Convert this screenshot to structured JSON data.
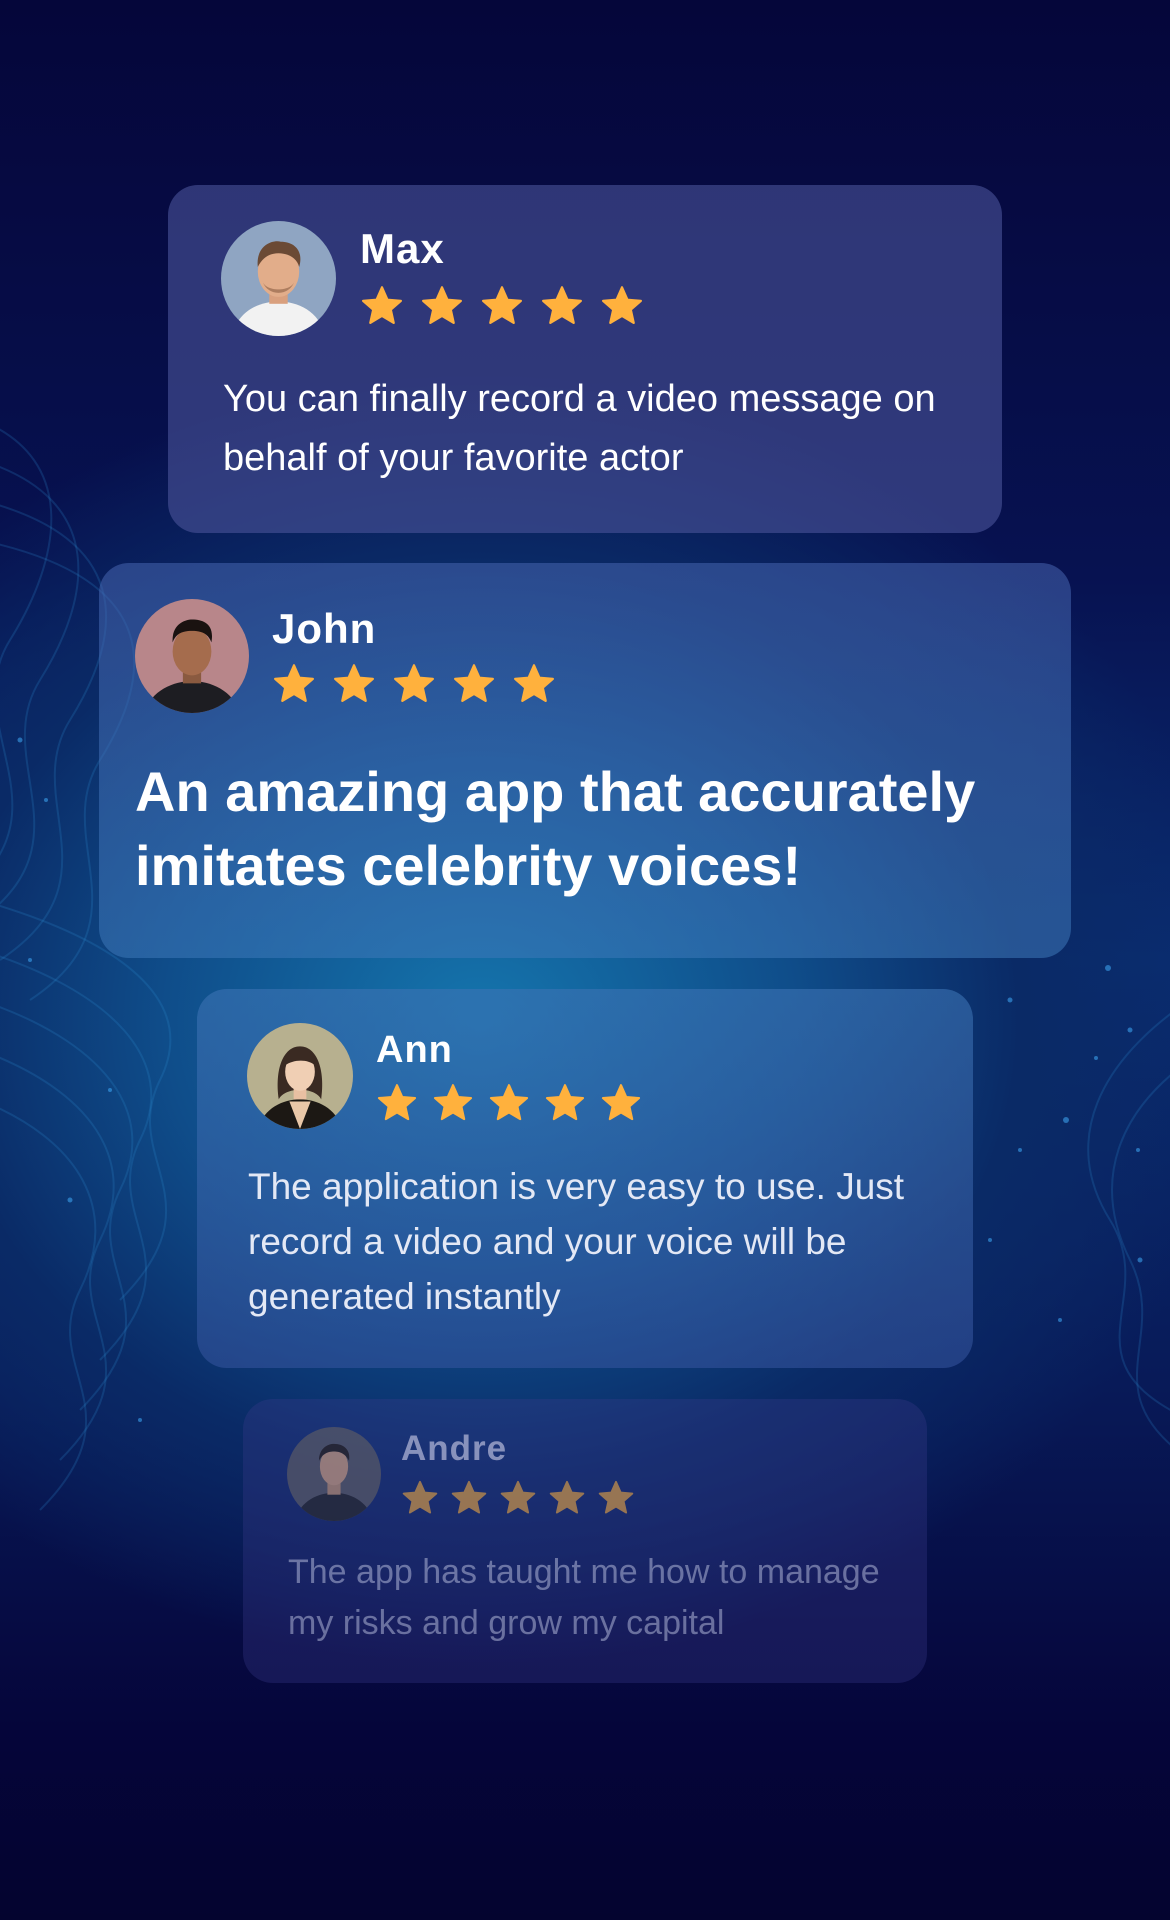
{
  "reviews": [
    {
      "name": "Max",
      "rating": 5,
      "text": "You can finally record a video message on behalf of your favorite actor"
    },
    {
      "name": "John",
      "rating": 5,
      "text": "An amazing app that accurately imitates celebrity voices!"
    },
    {
      "name": "Ann",
      "rating": 5,
      "text": "The application is very easy to use. Just record a video and your voice will be generated instantly"
    },
    {
      "name": "Andre",
      "rating": 5,
      "text": "The app has taught me how to manage  my risks and grow my capital"
    }
  ],
  "colors": {
    "star": "#ffb13d",
    "background_dark": "#05063a",
    "background_glow": "#1575ad"
  },
  "icons": {
    "star": "star-icon",
    "avatar": "avatar-photo"
  }
}
